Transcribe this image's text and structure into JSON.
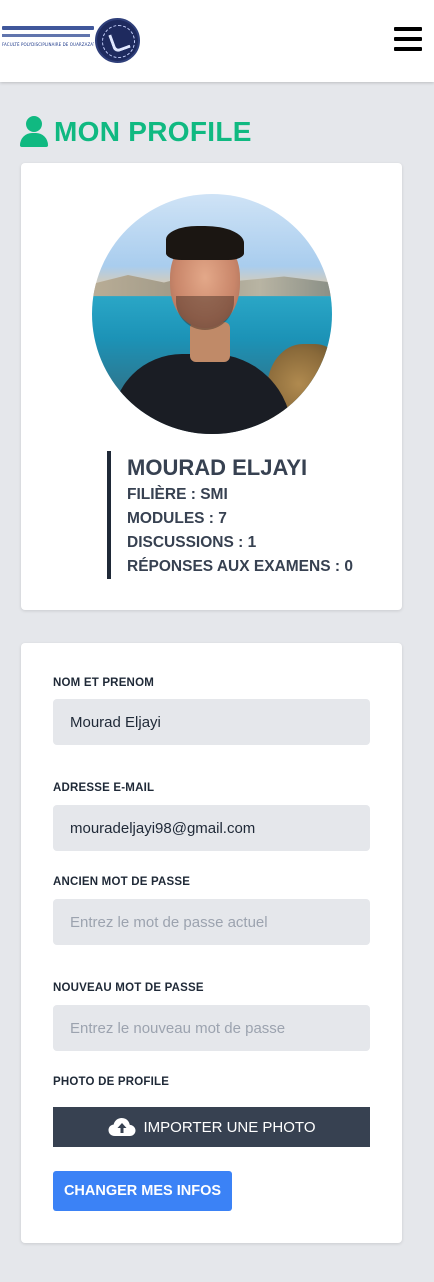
{
  "header": {
    "logo_alt": "Faculté Polydisciplinaire de Ouarzazate",
    "logo_caption": "FACULTÉ POLYDISCIPLINAIRE DE OUARZAZATE",
    "menu_icon": "hamburger-menu-icon"
  },
  "page": {
    "title": "MON PROFILE",
    "title_icon": "user-icon",
    "accent_color": "#10b981"
  },
  "profile": {
    "name": "MOURAD ELJAYI",
    "filiere": "FILIÈRE : SMI",
    "modules": "MODULES : 7",
    "discussions": "DISCUSSIONS : 1",
    "reponses": "RÉPONSES AUX EXAMENS : 0"
  },
  "form": {
    "name_label": "NOM ET PRENOM",
    "name_value": "Mourad Eljayi",
    "email_label": "ADRESSE E-MAIL",
    "email_value": "mouradeljayi98@gmail.com",
    "old_password_label": "ANCIEN MOT DE PASSE",
    "old_password_placeholder": "Entrez le mot de passe actuel",
    "new_password_label": "NOUVEAU MOT DE PASSE",
    "new_password_placeholder": "Entrez le nouveau mot de passe",
    "photo_label": "PHOTO DE PROFILE",
    "upload_label": "IMPORTER UNE PHOTO",
    "upload_icon": "cloud-upload-icon",
    "submit_label": "CHANGER MES INFOS",
    "submit_color": "#3b82f6"
  }
}
